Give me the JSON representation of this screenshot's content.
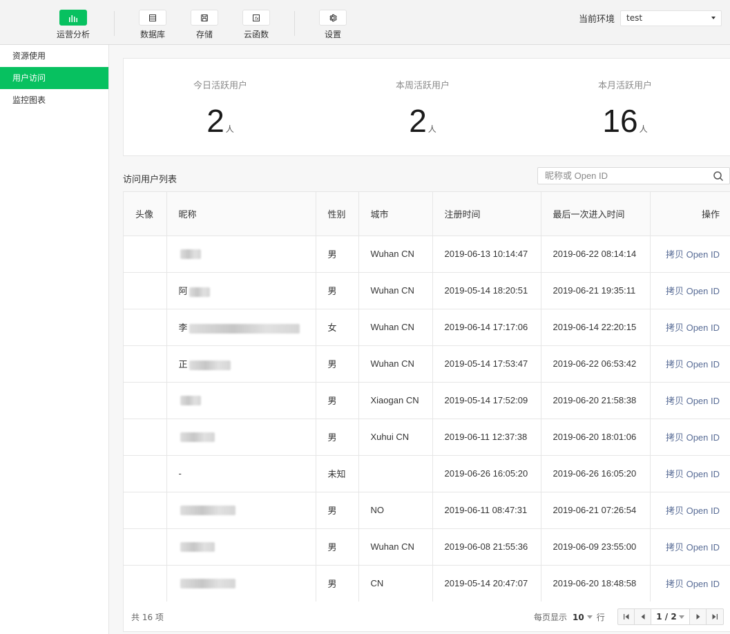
{
  "toolbar": {
    "items": [
      {
        "label": "运营分析",
        "icon": "bar-chart-icon",
        "active": true
      },
      {
        "label": "数据库",
        "icon": "database-icon"
      },
      {
        "label": "存储",
        "icon": "storage-icon"
      },
      {
        "label": "云函数",
        "icon": "function-icon"
      },
      {
        "label": "设置",
        "icon": "gear-icon"
      }
    ],
    "env_label": "当前环境",
    "env_value": "test"
  },
  "sidebar": {
    "items": [
      {
        "label": "资源使用"
      },
      {
        "label": "用户访问",
        "active": true
      },
      {
        "label": "监控图表"
      }
    ]
  },
  "stats": [
    {
      "label": "今日活跃用户",
      "value": "2",
      "unit": "人"
    },
    {
      "label": "本周活跃用户",
      "value": "2",
      "unit": "人"
    },
    {
      "label": "本月活跃用户",
      "value": "16",
      "unit": "人"
    }
  ],
  "list": {
    "title": "访问用户列表",
    "search_placeholder": "昵称或 Open ID",
    "columns": [
      "头像",
      "昵称",
      "性别",
      "城市",
      "注册时间",
      "最后一次进入时间",
      "操作"
    ],
    "rows": [
      {
        "avatar": "",
        "nickname_prefix": "",
        "gender": "男",
        "city": "Wuhan CN",
        "registered": "2019-06-13 10:14:47",
        "last_visit": "2019-06-22 08:14:14",
        "action": "拷贝 Open ID"
      },
      {
        "avatar": "",
        "nickname_prefix": "阿",
        "gender": "男",
        "city": "Wuhan CN",
        "registered": "2019-05-14 18:20:51",
        "last_visit": "2019-06-21 19:35:11",
        "action": "拷贝 Open ID"
      },
      {
        "avatar": "",
        "nickname_prefix": "李",
        "gender": "女",
        "city": "Wuhan CN",
        "registered": "2019-06-14 17:17:06",
        "last_visit": "2019-06-14 22:20:15",
        "action": "拷贝 Open ID"
      },
      {
        "avatar": "",
        "nickname_prefix": "正",
        "gender": "男",
        "city": "Wuhan CN",
        "registered": "2019-05-14 17:53:47",
        "last_visit": "2019-06-22 06:53:42",
        "action": "拷贝 Open ID"
      },
      {
        "avatar": "",
        "nickname_prefix": "",
        "gender": "男",
        "city": "Xiaogan CN",
        "registered": "2019-05-14 17:52:09",
        "last_visit": "2019-06-20 21:58:38",
        "action": "拷贝 Open ID"
      },
      {
        "avatar": "",
        "nickname_prefix": "",
        "gender": "男",
        "city": "Xuhui CN",
        "registered": "2019-06-11 12:37:38",
        "last_visit": "2019-06-20 18:01:06",
        "action": "拷贝 Open ID"
      },
      {
        "avatar": "",
        "nickname_prefix": "-",
        "gender": "未知",
        "city": "",
        "registered": "2019-06-26 16:05:20",
        "last_visit": "2019-06-26 16:05:20",
        "action": "拷贝 Open ID"
      },
      {
        "avatar": "",
        "nickname_prefix": "",
        "gender": "男",
        "city": "NO",
        "registered": "2019-06-11 08:47:31",
        "last_visit": "2019-06-21 07:26:54",
        "action": "拷贝 Open ID"
      },
      {
        "avatar": "",
        "nickname_prefix": "",
        "gender": "男",
        "city": "Wuhan CN",
        "registered": "2019-06-08 21:55:36",
        "last_visit": "2019-06-09 23:55:00",
        "action": "拷贝 Open ID"
      },
      {
        "avatar": "",
        "nickname_prefix": "",
        "gender": "男",
        "city": "CN",
        "registered": "2019-05-14 20:47:07",
        "last_visit": "2019-06-20 18:48:58",
        "action": "拷贝 Open ID"
      }
    ]
  },
  "footer": {
    "total": "共 16 项",
    "per_page_label": "每页显示",
    "per_page_value": "10",
    "per_page_unit": "行",
    "page_indicator": "1 / 2"
  },
  "colors": {
    "accent": "#07c160",
    "link": "#576b95"
  }
}
